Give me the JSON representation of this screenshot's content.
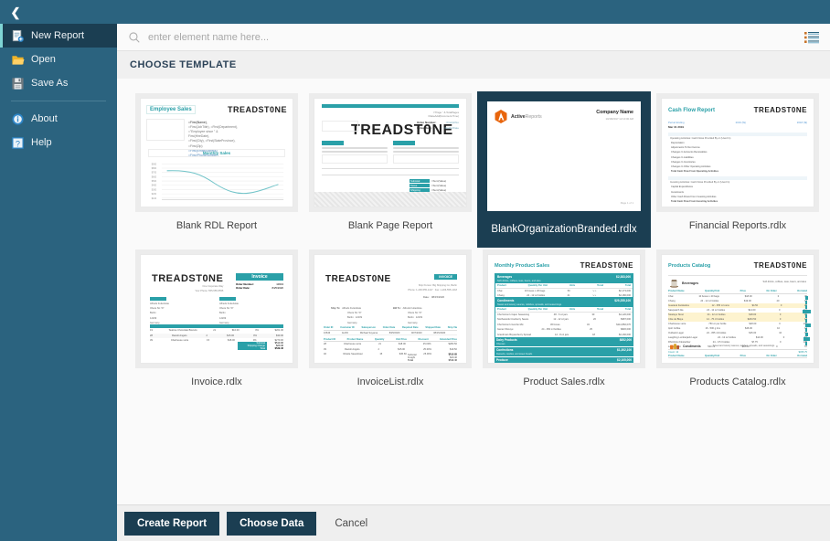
{
  "header": {
    "back_icon": "chevron-left-icon",
    "accent_color": "#2b637f"
  },
  "sidebar": {
    "items": [
      {
        "label": "New Report",
        "icon": "new-report-icon",
        "active": true
      },
      {
        "label": "Open",
        "icon": "folder-open-icon",
        "active": false
      },
      {
        "label": "Save As",
        "icon": "floppy-disk-icon",
        "active": false
      },
      {
        "label": "About",
        "icon": "info-circle-icon",
        "active": false
      },
      {
        "label": "Help",
        "icon": "question-box-icon",
        "active": false
      }
    ]
  },
  "search": {
    "placeholder": "enter element name here...",
    "value": "",
    "icon": "search-icon",
    "view_toggle_icon": "list-view-icon"
  },
  "main": {
    "section_title": "CHOOSE TEMPLATE",
    "templates": [
      {
        "label": "Blank RDL Report",
        "selected": false,
        "preview": {
          "kind": "rdl-chart",
          "title": "Employee Sales",
          "brand": "TREADST0NE",
          "chart_title": "Monthly Sales",
          "expr_lines": [
            "=First(Name),",
            "=First(JobTitle), =First(Department),",
            "=\"Employee since \" & First(HireDate),",
            "=First(City), =First(StateProvince), =First(Zip)",
            "=First(EmailAddress)",
            "=First(PhoneNumber)"
          ]
        }
      },
      {
        "label": "Blank Page Report",
        "selected": false,
        "preview": {
          "kind": "page-invoice",
          "title": "Invoice",
          "brand": "TREADST0NE",
          "fields": [
            "Bill To:",
            "Ship To:",
            "Order Number:",
            "Order Date:"
          ],
          "totals": [
            "Subtotal",
            "Taxes",
            "Shipping",
            "Total"
          ]
        }
      },
      {
        "label": "BlankOrganizationBranded.rdlx",
        "selected": true,
        "preview": {
          "kind": "organization-branded",
          "logo": "activereports-logo",
          "logo_text_strong": "Active",
          "logo_text_light": "Reports",
          "company": "Company Name",
          "date_line": "10/18/2017 12:10:00 AM",
          "footer": "Page 1 of 1"
        }
      },
      {
        "label": "Financial Reports.rdlx",
        "selected": false,
        "preview": {
          "kind": "financial",
          "title": "Cash Flow Report",
          "brand": "TREADST0NE",
          "sections": [
            "Operating Activities: Cash Flows Provided By or (Used In)",
            "Investing Activities: Cash Flows Provided By or (Used In)",
            "Financing Activities: Cash Flows Provided By or (Used In)"
          ]
        }
      },
      {
        "label": "Invoice.rdlx",
        "selected": false,
        "preview": {
          "kind": "invoice",
          "brand": "TREADST0NE",
          "badge": "Invoice",
          "totals": [
            "Subtotal",
            "Shipping Charge",
            "Total"
          ]
        }
      },
      {
        "label": "InvoiceList.rdlx",
        "selected": false,
        "preview": {
          "kind": "invoice-list",
          "brand": "TREADST0NE",
          "badge": "INVOICE",
          "totals": [
            "Subtotal",
            "Freight",
            "Total"
          ]
        }
      },
      {
        "label": "Product Sales.rdlx",
        "selected": false,
        "preview": {
          "kind": "product-sales",
          "title": "Monthly Product Sales",
          "brand": "TREADST0NE",
          "groups": [
            "Beverages",
            "Condiments",
            "Dairy Products",
            "Confections",
            "Produce"
          ]
        }
      },
      {
        "label": "Products Catalog.rdlx",
        "selected": false,
        "preview": {
          "kind": "products-catalog",
          "title": "Products Catalog",
          "brand": "TREADST0NE",
          "groups": [
            "Beverages",
            "Condiments"
          ],
          "columns": [
            "Product Name",
            "Quantity/Unit",
            "Price",
            "On Order",
            "On Hand"
          ]
        }
      }
    ]
  },
  "footer": {
    "create_label": "Create Report",
    "choose_data_label": "Choose Data",
    "cancel_label": "Cancel"
  }
}
